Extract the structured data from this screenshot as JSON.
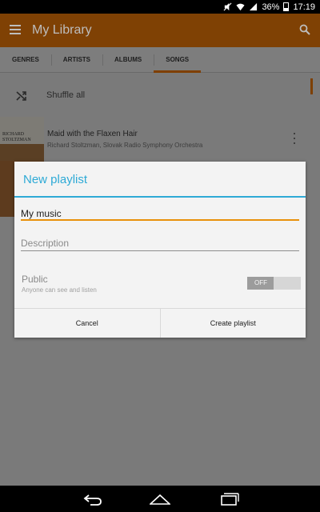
{
  "status_bar": {
    "battery": "36%",
    "time": "17:19"
  },
  "app_bar": {
    "title": "My Library",
    "menu_icon": "hamburger-menu-icon",
    "search_icon": "search-icon",
    "color": "#e07a00"
  },
  "tabs": [
    {
      "label": "GENRES",
      "active": false
    },
    {
      "label": "ARTISTS",
      "active": false
    },
    {
      "label": "ALBUMS",
      "active": false
    },
    {
      "label": "SONGS",
      "active": true
    }
  ],
  "list": {
    "shuffle_label": "Shuffle all",
    "songs": [
      {
        "title": "Maid with the Flaxen Hair",
        "artist": "Richard Stoltzman, Slovak Radio Symphony Orchestra",
        "album_art_text": "RICHARD STOLTZMAN"
      }
    ]
  },
  "dialog": {
    "title": "New playlist",
    "name_value": "My music",
    "description_placeholder": "Description",
    "public_label": "Public",
    "public_sublabel": "Anyone can see and listen",
    "public_toggle": "OFF",
    "cancel_label": "Cancel",
    "create_label": "Create playlist",
    "accent_color": "#2eaad6",
    "focus_color": "#e8900a"
  },
  "nav_bar": {
    "back_icon": "back-icon",
    "home_icon": "home-icon",
    "recents_icon": "recents-icon"
  }
}
